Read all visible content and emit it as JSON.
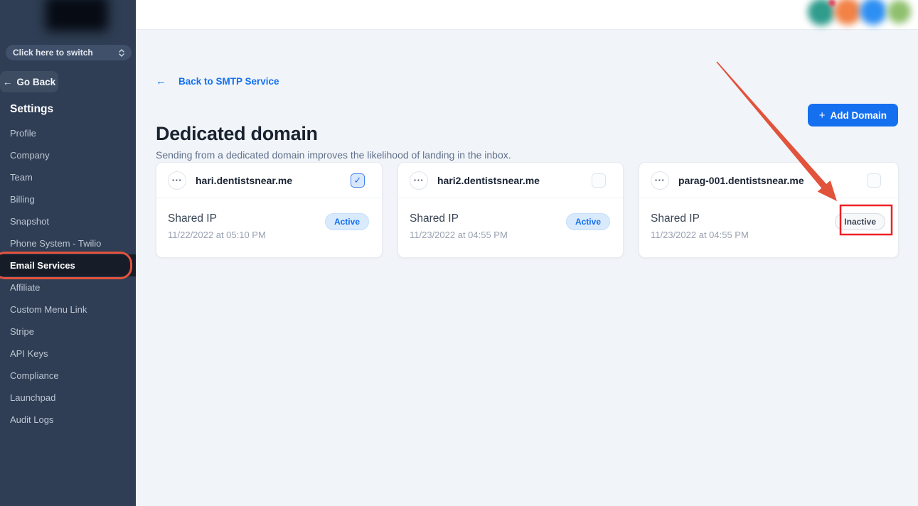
{
  "icons": {
    "ellipsis": "···",
    "back_arrow": "←",
    "plus": "+",
    "checkmark": "✓"
  },
  "sidebar": {
    "switcher": {
      "label": "Click here to switch"
    },
    "go_back": {
      "label": "Go Back"
    },
    "section_title": "Settings",
    "items": [
      {
        "label": "Profile"
      },
      {
        "label": "Company"
      },
      {
        "label": "Team"
      },
      {
        "label": "Billing"
      },
      {
        "label": "Snapshot"
      },
      {
        "label": "Phone System - Twilio"
      },
      {
        "label": "Email Services",
        "active": true
      },
      {
        "label": "Affiliate"
      },
      {
        "label": "Custom Menu Link"
      },
      {
        "label": "Stripe"
      },
      {
        "label": "API Keys"
      },
      {
        "label": "Compliance"
      },
      {
        "label": "Launchpad"
      },
      {
        "label": "Audit Logs"
      }
    ]
  },
  "main": {
    "back_link": "Back to SMTP Service",
    "title": "Dedicated domain",
    "subtitle": "Sending from a dedicated domain improves the likelihood of landing in the inbox.",
    "add_domain_label": "Add Domain"
  },
  "cards": [
    {
      "domain": "hari.dentistsnear.me",
      "checked": true,
      "ip_type": "Shared IP",
      "created": "11/22/2022 at 05:10 PM",
      "status": "Active"
    },
    {
      "domain": "hari2.dentistsnear.me",
      "checked": false,
      "ip_type": "Shared IP",
      "created": "11/23/2022 at 04:55 PM",
      "status": "Active"
    },
    {
      "domain": "parag-001.dentistsnear.me",
      "checked": false,
      "ip_type": "Shared IP",
      "created": "11/23/2022 at 04:55 PM",
      "status": "Inactive"
    }
  ],
  "annotations": {
    "highlighted_sidebar_item": "Email Services",
    "highlighted_status_badge": "Inactive",
    "outline_color": "#e2533c",
    "rect_color": "#ee2024"
  },
  "colors": {
    "accent_blue": "#1570ef",
    "sidebar_bg": "#2f3e54",
    "active_item_bg": "#161d29",
    "content_bg": "#f1f5f9",
    "avatar_colors": [
      "#2f9c8c",
      "#f28246",
      "#2e8ff2",
      "#8fc06e"
    ]
  }
}
